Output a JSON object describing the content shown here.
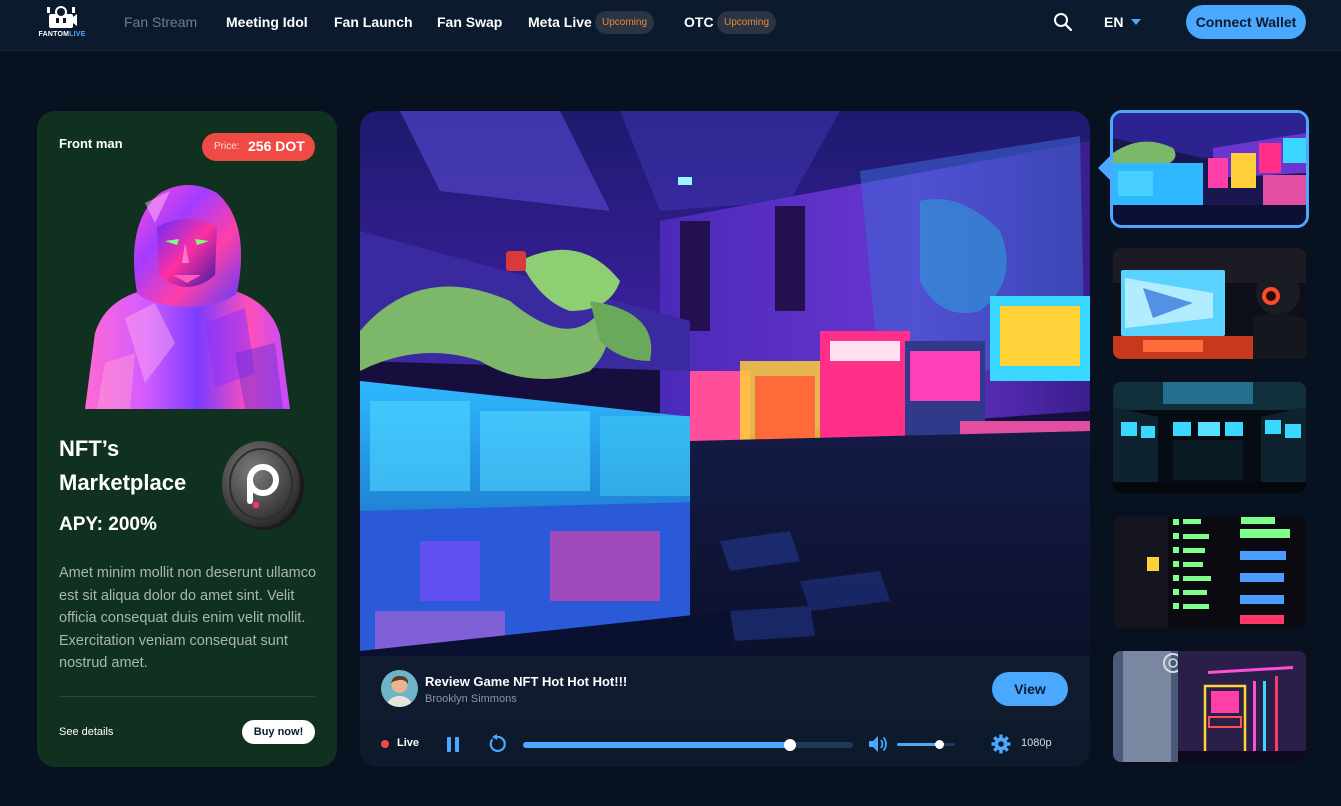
{
  "brand": {
    "name_part1": "FANTOM",
    "name_part2": "LIVE"
  },
  "nav": {
    "items": [
      {
        "label": "Fan Stream",
        "state": "current"
      },
      {
        "label": "Meeting Idol"
      },
      {
        "label": "Fan Launch"
      },
      {
        "label": "Fan Swap"
      },
      {
        "label": "Meta Live",
        "badge": "Upcoming"
      },
      {
        "label": "OTC",
        "badge": "Upcoming"
      }
    ],
    "language": "EN",
    "connect_label": "Connect Wallet"
  },
  "card": {
    "owner": "Front man",
    "price_label": "Price:",
    "price_value": "256 DOT",
    "title_line1": "NFT’s",
    "title_line2": "Marketplace",
    "apy": "APY: 200%",
    "description": "Amet minim mollit non deserunt ullamco est sit aliqua dolor do amet sint. Velit officia consequat duis enim velit mollit. Exercitation veniam consequat sunt nostrud amet.",
    "details_label": "See details",
    "buy_label": "Buy now!"
  },
  "player": {
    "video_title": "Review Game NFT Hot Hot Hot!!!",
    "author": "Brooklyn Simmons",
    "view_label": "View",
    "live_label": "Live",
    "quality": "1080p",
    "progress": 0.81,
    "volume": 0.72
  },
  "colors": {
    "accent": "#4aa8ff",
    "card_bg": "#10311f",
    "price": "#ef4a44",
    "badge_text": "#e48c3a",
    "page_bg": "#081120"
  },
  "thumbnails": [
    {
      "scene": "arcade-hall",
      "active": true
    },
    {
      "scene": "gamer-headset"
    },
    {
      "scene": "dark-arcade-room"
    },
    {
      "scene": "neon-scoreboard"
    },
    {
      "scene": "neon-arcade-machine"
    }
  ]
}
